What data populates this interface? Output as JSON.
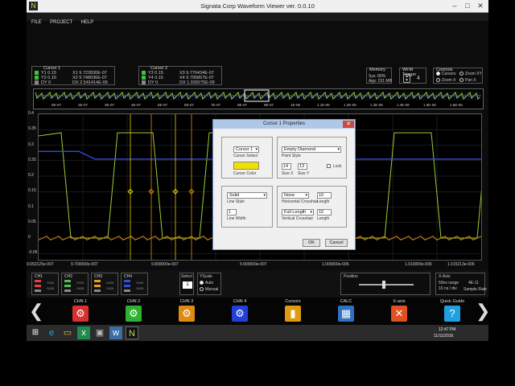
{
  "window": {
    "title": "Signata Corp Waveform Viewer ver. 0.0.10"
  },
  "menu": [
    "FILE",
    "PROJECT",
    "HELP"
  ],
  "cursor1": {
    "title": "Cursor 1",
    "y1_label": "Y1",
    "y1_val": "0.15",
    "y2_label": "Y2",
    "y2_val": "0.15",
    "dy_label": "DY",
    "dy_val": "0",
    "x1_label": "X1",
    "x1_val": "9.722830E-07",
    "x2_label": "X2",
    "x2_val": "9.748036E-07",
    "dx_label": "DX",
    "dx_val": "2.541414E-09"
  },
  "cursor2": {
    "title": "Cursor 2",
    "y3_label": "Y3",
    "y3_val": "0.15",
    "y4_label": "Y4",
    "y4_val": "0.15",
    "dy_label": "DY",
    "dy_val": "0",
    "x3_label": "X3",
    "x3_val": "9.776434E-07",
    "x4_label": "X4",
    "x4_val": "9.795857E-07",
    "dx_label": "DX",
    "dx_val": "1.939275E-09"
  },
  "memory": {
    "title": "Memory",
    "sys_label": "Sys: 80%",
    "app_label": "App: 231 MB"
  },
  "wfm_trigger": {
    "title": "WFM Trigger",
    "value": "4"
  },
  "controls": {
    "title": "Controls",
    "options": [
      "Cursors",
      "Zoom XY",
      "Zoom X",
      "Pan X"
    ]
  },
  "overview_ticks": [
    "0E-07",
    "2E-07",
    "3E-07",
    "4E-07",
    "5E-07",
    "6E-07",
    "7E-07",
    "8E-07",
    "9E-07",
    "1E-06",
    "1.1E-06",
    "1.2E-06",
    "1.3E-06",
    "1.4E-06",
    "1.5E-06",
    "1.6E-06"
  ],
  "y_ticks": [
    "0.4",
    "0.35",
    "0.3",
    "0.25",
    "0.2",
    "0.15",
    "0.1",
    "0.05",
    "0",
    "-0.05"
  ],
  "x_ticks": [
    "9.652125e-007",
    "9.700000e-007",
    "9.800000e-007",
    "9.900000e-007",
    "1.000000e-006",
    "1.010000e-006",
    "1.015213e-006"
  ],
  "channels": [
    {
      "name": "CH1",
      "color": "#e04040"
    },
    {
      "name": "CH2",
      "color": "#50c050"
    },
    {
      "name": "CH3",
      "color": "#e0a020"
    },
    {
      "name": "CH4",
      "color": "#3050e0"
    }
  ],
  "channel_sub": [
    "Auto",
    "Auto"
  ],
  "select": {
    "title": "Select",
    "value": "1"
  },
  "yscale": {
    "title": "YScale",
    "auto": "Auto",
    "manual": "Manual"
  },
  "position": {
    "title": "Position",
    "level": 0.45
  },
  "xaxis": {
    "title": "X-Axis",
    "rangeline1": "50ns range",
    "rangeline2": "10 ns / div",
    "value": "4E-11",
    "sr_label": "Sample Rate"
  },
  "toolbar": {
    "items": [
      {
        "label": "CHN 1",
        "icon": "gear-icon",
        "color": "#d83030"
      },
      {
        "label": "CHN 2",
        "icon": "gear-icon",
        "color": "#30b030"
      },
      {
        "label": "CHN 3",
        "icon": "gear-icon",
        "color": "#e08a10"
      },
      {
        "label": "CHN 4",
        "icon": "gear-icon",
        "color": "#2040d8"
      },
      {
        "label": "Cursors",
        "icon": "cursor-icon",
        "color": "#e09a10"
      },
      {
        "label": "CALC",
        "icon": "calculator-icon",
        "color": "#3070c0"
      },
      {
        "label": "X-axis",
        "icon": "x-axis-icon",
        "color": "#e05020"
      },
      {
        "label": "Quick Guide",
        "icon": "guide-icon",
        "color": "#20a0e0"
      }
    ]
  },
  "dialog": {
    "title": "Cursor 1 Properties",
    "cursor_select": "Cursor 1",
    "cursor_select_label": "Cursor Select",
    "cursor_color_label": "Cursor Color",
    "cursor_color": "#f0e000",
    "point_style": "Empty Diamond",
    "point_style_label": "Point Style",
    "size_x": "14",
    "size_y": "13",
    "size_x_label": "Size X",
    "size_y_label": "Size Y",
    "lock_label": "Lock",
    "line_style": "Solid",
    "line_style_label": "Line Style",
    "line_width": "1",
    "line_width_label": "Line Width",
    "h_crosshair": "None",
    "h_crosshair_label": "Horizontal Crosshair",
    "h_length": "10",
    "h_length_label": "Length",
    "v_crosshair": "Full Length",
    "v_crosshair_label": "Vertical Crosshair",
    "v_length": "10",
    "v_length_label": "Length",
    "ok": "OK",
    "cancel": "Cancel"
  },
  "taskbar": {
    "time": "12:47 PM",
    "date": "11/11/2016"
  }
}
